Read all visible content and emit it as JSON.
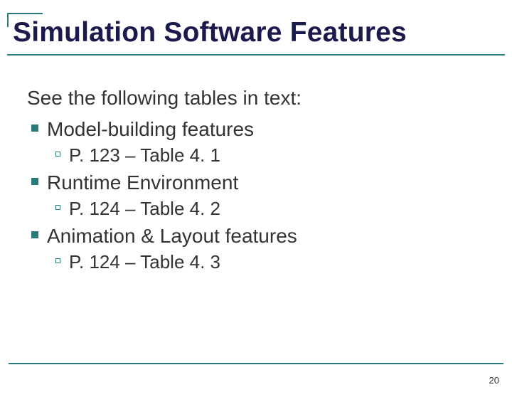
{
  "title": "Simulation Software Features",
  "intro": "See the following tables in text:",
  "items": [
    {
      "label": "Model-building features",
      "sub": "P. 123 – Table 4. 1"
    },
    {
      "label": "Runtime Environment",
      "sub": "P. 124 – Table 4. 2"
    },
    {
      "label": "Animation & Layout features",
      "sub": "P. 124 – Table 4. 3"
    }
  ],
  "page_number": "20"
}
